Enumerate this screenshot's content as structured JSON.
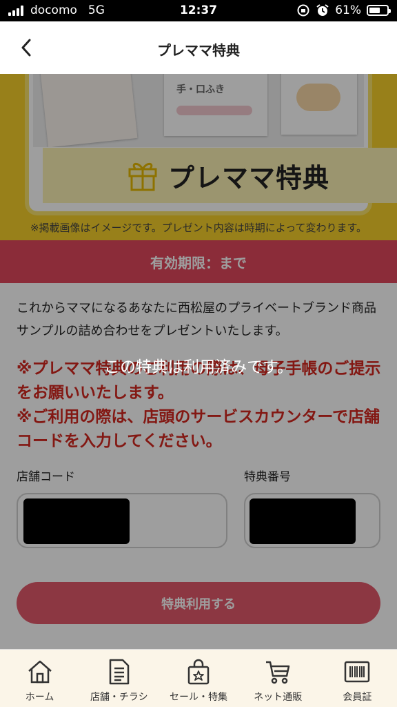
{
  "status_bar": {
    "carrier": "docomo",
    "network": "5G",
    "time": "12:37",
    "battery": "61%",
    "battery_level": 0.61
  },
  "nav": {
    "title": "プレママ特典",
    "back_icon": "chevron-left-icon"
  },
  "banner": {
    "product_label_1": "手・口ふき",
    "title": "プレママ特典",
    "gift_icon": "gift-icon",
    "note": "※掲載画像はイメージです。プレゼント内容は時期によって変わります。"
  },
  "expiry": {
    "text": "有効期限：まで"
  },
  "description": "これからママになるあなたに西松屋のプライベートブランド商品サンプルの詰め合わせをプレゼントいたします。",
  "notices": [
    "※プレママ特典のご利用の際は、母子手帳のご提示をお願いいたします。",
    "※ご利用の際は、店頭のサービスカウンターで店舗コードを入力してください。"
  ],
  "form": {
    "store_code_label": "店舗コード",
    "coupon_number_label": "特典番号"
  },
  "use_button": {
    "label": "特典利用する"
  },
  "overlay": {
    "message": "この特典は利用済みです。"
  },
  "tabbar": [
    {
      "label": "ホーム",
      "icon": "home-icon"
    },
    {
      "label": "店舗・チラシ",
      "icon": "flyer-icon"
    },
    {
      "label": "セール・特集",
      "icon": "shopping-bag-icon"
    },
    {
      "label": "ネット通販",
      "icon": "cart-icon"
    },
    {
      "label": "会員証",
      "icon": "barcode-card-icon"
    }
  ],
  "colors": {
    "banner_yellow": "#f5cf2a",
    "expiry_red": "#e0475d",
    "notice_red": "#d3271f",
    "button_pink": "#e35a6b",
    "tabbar_bg": "#fbf5e8"
  }
}
